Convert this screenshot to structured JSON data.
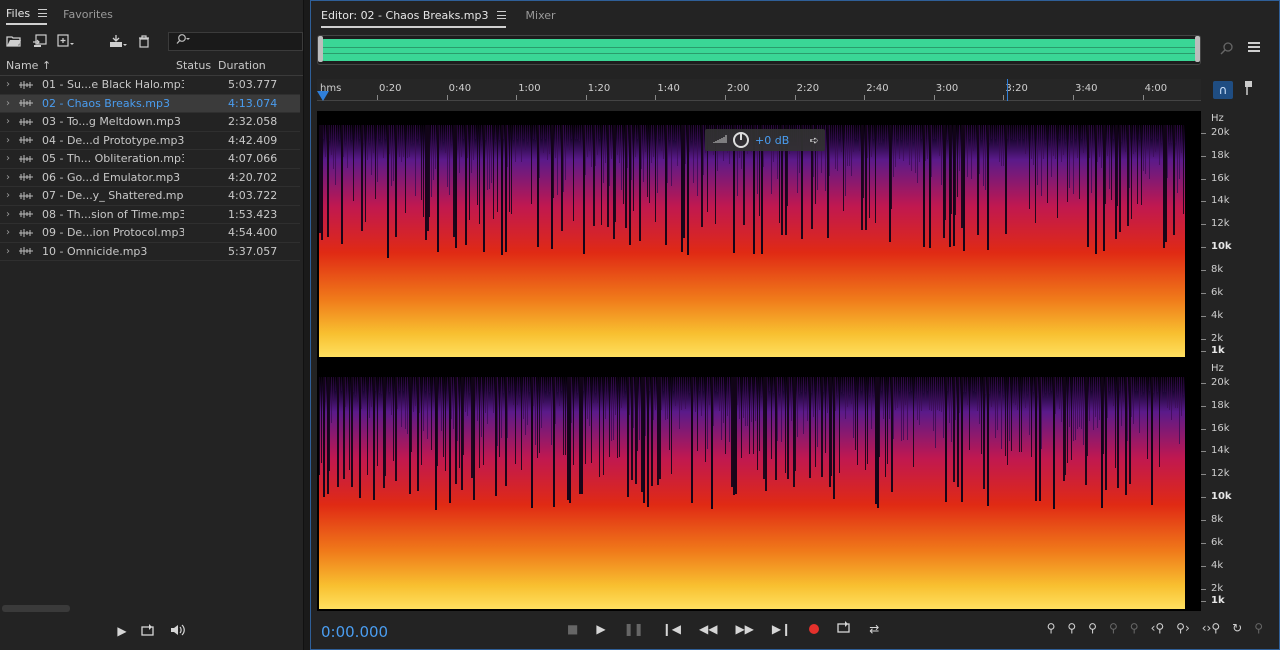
{
  "files_panel": {
    "tabs": [
      {
        "label": "Files",
        "active": true
      },
      {
        "label": "Favorites",
        "active": false
      }
    ],
    "search": {
      "placeholder": ""
    },
    "columns": {
      "name": "Name ↑",
      "status": "Status",
      "duration": "Duration"
    },
    "files": [
      {
        "name": "01 - Su...e Black Halo.mp3",
        "status": "",
        "duration": "5:03.777",
        "selected": false
      },
      {
        "name": "02 - Chaos Breaks.mp3",
        "status": "",
        "duration": "4:13.074",
        "selected": true
      },
      {
        "name": "03 - To...g Meltdown.mp3",
        "status": "",
        "duration": "2:32.058",
        "selected": false
      },
      {
        "name": "04 - De...d Prototype.mp3",
        "status": "",
        "duration": "4:42.409",
        "selected": false
      },
      {
        "name": "05 - Th... Obliteration.mp3",
        "status": "",
        "duration": "4:07.066",
        "selected": false
      },
      {
        "name": "06 - Go...d Emulator.mp3",
        "status": "",
        "duration": "4:20.702",
        "selected": false
      },
      {
        "name": "07 - De...y_ Shattered.mp3",
        "status": "",
        "duration": "4:03.722",
        "selected": false
      },
      {
        "name": "08 - Th...sion of Time.mp3",
        "status": "",
        "duration": "1:53.423",
        "selected": false
      },
      {
        "name": "09 - De...ion Protocol.mp3",
        "status": "",
        "duration": "4:54.400",
        "selected": false
      },
      {
        "name": "10 - Omnicide.mp3",
        "status": "",
        "duration": "5:37.057",
        "selected": false
      }
    ]
  },
  "editor": {
    "tabs": [
      {
        "label": "Editor: 02 - Chaos Breaks.mp3",
        "active": true
      },
      {
        "label": "Mixer",
        "active": false
      }
    ],
    "ruler": {
      "unit": "hms",
      "labels": [
        "0:20",
        "0:40",
        "1:00",
        "1:20",
        "1:40",
        "2:00",
        "2:20",
        "2:40",
        "3:00",
        "3:20",
        "3:40",
        "4:00"
      ]
    },
    "hud": {
      "gain": "+0 dB"
    },
    "freq_labels": [
      "Hz",
      "20k",
      "18k",
      "16k",
      "14k",
      "12k",
      "10k",
      "8k",
      "6k",
      "4k",
      "2k",
      "1k"
    ],
    "time_display": "0:00.000",
    "colors": {
      "accent": "#4a9df0",
      "waveform": "#3ad696",
      "record": "#e4312c"
    }
  }
}
